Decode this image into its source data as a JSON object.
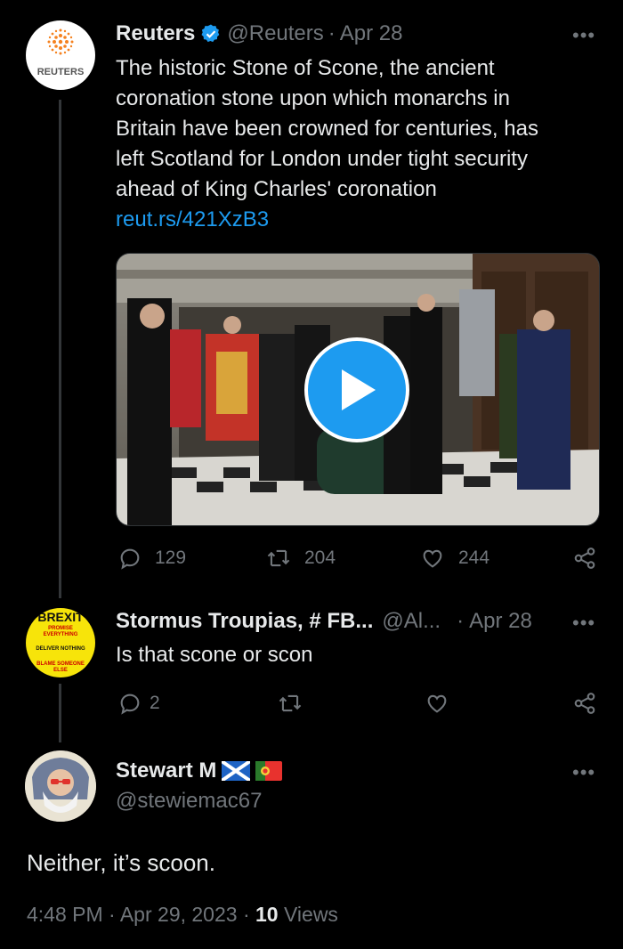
{
  "tweet1": {
    "avatar_text": "REUTERS",
    "name": "Reuters",
    "handle": "@Reuters",
    "sep": "·",
    "date": "Apr 28",
    "lines": [
      "The historic Stone of Scone, the ancient",
      "coronation stone upon which monarchs in",
      "Britain have been crowned for centuries, has",
      "left Scotland for London under tight security",
      "ahead of King Charles' coronation"
    ],
    "link": "reut.rs/421XzB3",
    "replies": "129",
    "retweets": "204",
    "likes": "244",
    "more": "•••"
  },
  "tweet2": {
    "avatar_lines": [
      "BREXIT",
      "PROMISE",
      "EVERYTHING",
      "DELIVER NOTHING",
      "BLAME SOMEONE",
      "ELSE"
    ],
    "name": "Stormus Troupias, # FB...",
    "handle": "@Al...",
    "sep": "·",
    "date": "Apr 28",
    "text": "Is that scone or scon",
    "replies": "2",
    "more": "•••"
  },
  "tweet3": {
    "name": "Stewart M",
    "handle": "@stewiemac67",
    "text": "Neither, it’s scoon.",
    "time": "4:48 PM",
    "sep1": "·",
    "date": "Apr 29, 2023",
    "sep2": "·",
    "views_count": "10",
    "views_label": "Views",
    "more": "•••"
  },
  "colors": {
    "accent": "#1d9bf0",
    "muted": "#71767b",
    "text": "#e7e9ea",
    "background": "#000000"
  }
}
